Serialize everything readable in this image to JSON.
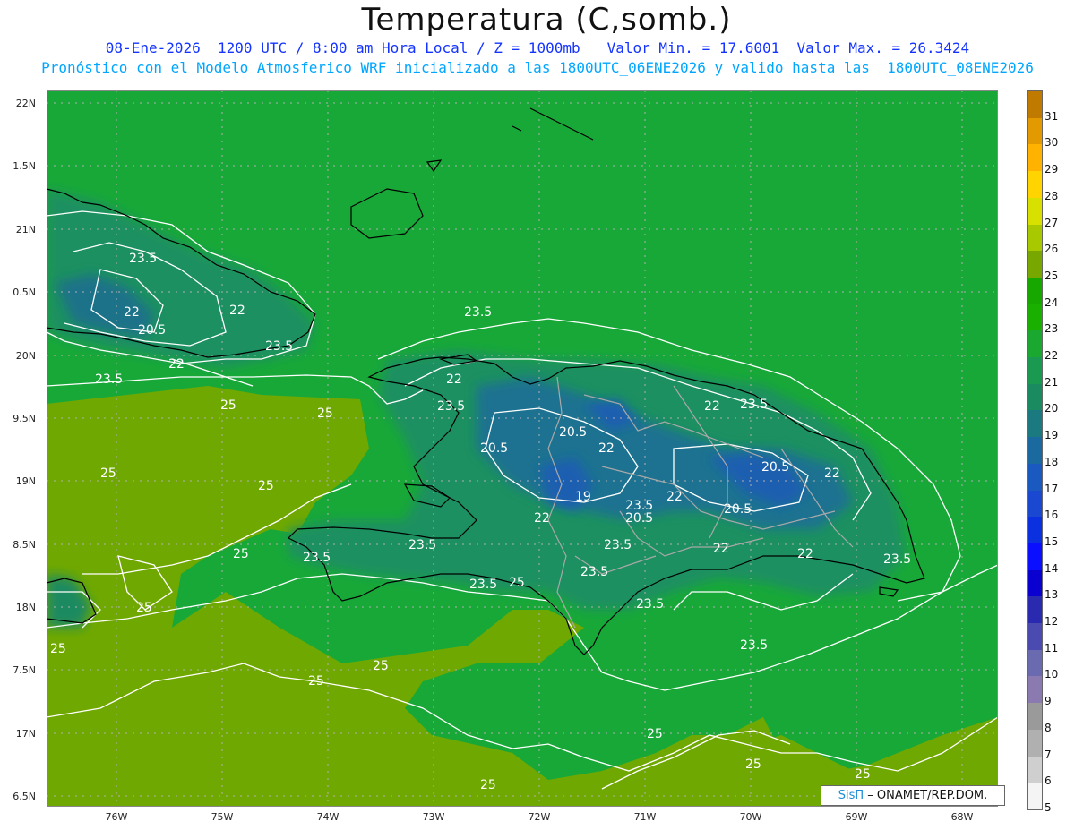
{
  "header": {
    "title": "Temperatura (C,somb.)",
    "line1_left": "08-Ene-2026  1200 UTC / 8:00 am Hora Local / Z = 1000mb",
    "line1_right": "Valor Min. = 17.6001  Valor Max. = 26.3424",
    "line2": "Pronóstico con el Modelo Atmosferico WRF inicializado a las 1800UTC_06ENE2026 y valido hasta las  1800UTC_08ENE2026"
  },
  "axes": {
    "lat_labels": [
      "22N",
      "1.5N",
      "21N",
      "0.5N",
      "20N",
      "9.5N",
      "19N",
      "8.5N",
      "18N",
      "7.5N",
      "17N",
      "6.5N"
    ],
    "lon_labels": [
      "76W",
      "75W",
      "74W",
      "73W",
      "72W",
      "71W",
      "70W",
      "69W",
      "68W"
    ]
  },
  "contour_labels": [
    "25",
    "23.5",
    "22",
    "20.5",
    "19"
  ],
  "credit": {
    "brand": "SisΠ",
    "text": " – ONAMET/REP.DOM."
  },
  "colorbar": {
    "labels": [
      "31",
      "30",
      "29",
      "28",
      "27",
      "26",
      "25",
      "24",
      "23",
      "22",
      "21",
      "20",
      "19",
      "18",
      "17",
      "16",
      "15",
      "14",
      "13",
      "12",
      "11",
      "10",
      "9",
      "8",
      "7",
      "6",
      "5"
    ],
    "colors": [
      "#c07a00",
      "#e29a00",
      "#ffb300",
      "#ffd400",
      "#d8e000",
      "#a8c800",
      "#78a800",
      "#17a800",
      "#19b000",
      "#1aa830",
      "#1a9a50",
      "#1a8a60",
      "#1a7a80",
      "#1a6aa0",
      "#1a5ac0",
      "#1a48d0",
      "#0a30e0",
      "#0a10ff",
      "#0a00d0",
      "#2a2ab0",
      "#4a4ab0",
      "#6a6ab0",
      "#8a7ab0",
      "#9a9a9a",
      "#b0b0b0",
      "#cfcfcf",
      "#f4f4f4"
    ]
  }
}
